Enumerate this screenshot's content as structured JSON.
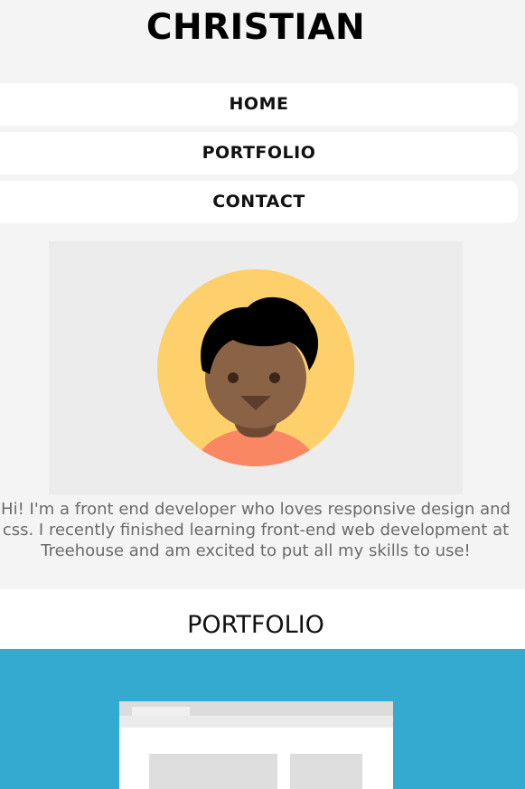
{
  "header": {
    "site_title": "CHRISTIAN"
  },
  "nav": {
    "items": [
      {
        "label": "HOME"
      },
      {
        "label": "PORTFOLIO"
      },
      {
        "label": "CONTACT"
      }
    ]
  },
  "about": {
    "bio_lines": [
      "Hi! I'm a front end developer who loves responsive design and",
      "css. I recently finished learning front-end web development at",
      "Treehouse and am excited to put all my skills to use!"
    ]
  },
  "portfolio": {
    "heading": "PORTFOLIO"
  },
  "colors": {
    "page_background": "#f4f4f4",
    "nav_background": "#ffffff",
    "avatar_panel": "#ececec",
    "avatar_circle": "#fdd06b",
    "avatar_skin": "#8a6246",
    "avatar_hair": "#000000",
    "avatar_shirt": "#f98763",
    "banner": "#35aad0",
    "bio_text": "#6b6b6b"
  },
  "icons": {
    "avatar": "person-avatar-icon",
    "portfolio_preview": "browser-window-icon"
  }
}
